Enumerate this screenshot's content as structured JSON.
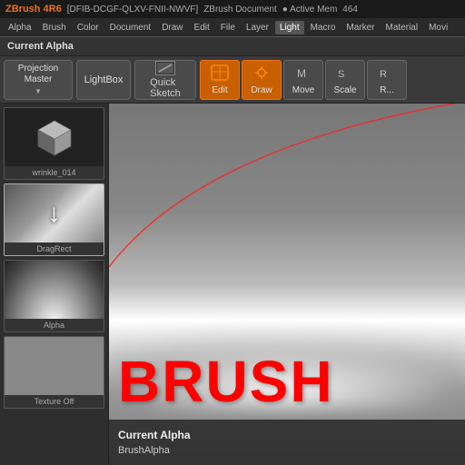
{
  "titleBar": {
    "app": "ZBrush 4R6",
    "license": "[DFIB-DCGF-QLXV-FNII-NWVF]",
    "doc": "ZBrush Document",
    "memLabel": "● Active Mem",
    "memValue": "464"
  },
  "menuBar": {
    "items": [
      "Alpha",
      "Brush",
      "Color",
      "Document",
      "Draw",
      "Edit",
      "File",
      "Layer",
      "Light",
      "Macro",
      "Marker",
      "Material",
      "Movie"
    ]
  },
  "currentAlphaBar": {
    "label": "Current Alpha"
  },
  "toolbar": {
    "projectionMaster": "Projection\nMaster",
    "lightbox": "LightBox",
    "quickSketch": "Quick\nSketch",
    "edit": "Edit",
    "draw": "Draw",
    "move": "Move",
    "scale": "Scale",
    "rotate": "R..."
  },
  "leftPanel": {
    "items": [
      {
        "label": "wrinkle_014",
        "type": "cube"
      },
      {
        "label": "DragRect",
        "type": "dragrect"
      },
      {
        "label": "Alpha",
        "type": "alpha"
      },
      {
        "label": "Texture Off",
        "type": "texture"
      }
    ]
  },
  "canvas": {
    "brushText": "BRUSH",
    "infoLine1": "Current Alpha",
    "infoLine2": "BrushAlpha"
  }
}
